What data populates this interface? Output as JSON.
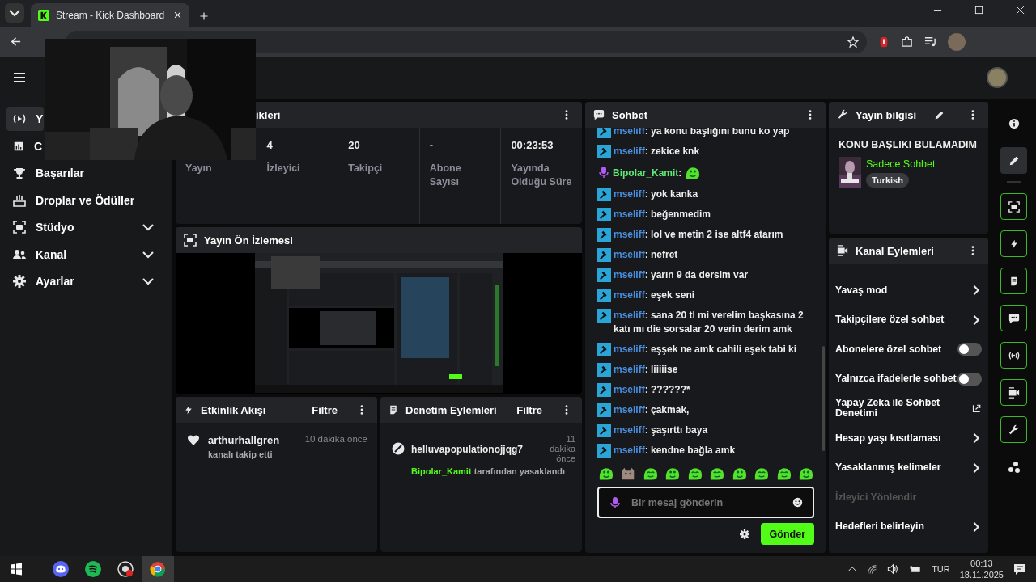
{
  "browser": {
    "tab_title": "Stream - Kick Dashboard"
  },
  "sidebar": {
    "items": [
      {
        "label": "Y",
        "kind": "link",
        "selected": true
      },
      {
        "label": "C",
        "kind": "link",
        "selected": false
      },
      {
        "label": "Başarılar",
        "kind": "link",
        "selected": false
      },
      {
        "label": "Droplar ve Ödüller",
        "kind": "link",
        "selected": false
      },
      {
        "label": "Stüdyo",
        "kind": "group",
        "selected": false,
        "expanded": false
      },
      {
        "label": "Kanal",
        "kind": "group",
        "selected": false,
        "expanded": false
      },
      {
        "label": "Ayarlar",
        "kind": "group",
        "selected": false,
        "expanded": false
      }
    ]
  },
  "stats_panel": {
    "title": "ikleri",
    "stats": [
      {
        "label": "Yayın"
      },
      {
        "value": "4",
        "label": "İzleyici"
      },
      {
        "value": "20",
        "label": "Takipçi"
      },
      {
        "value": "-",
        "label": "Abone Sayısı"
      },
      {
        "value": "00:23:53",
        "label": "Yayında Olduğu Süre"
      }
    ]
  },
  "preview_panel": {
    "title": "Yayın Ön İzlemesi"
  },
  "activity_panel": {
    "title": "Etkinlik Akışı",
    "filter": "Filtre",
    "events": [
      {
        "user": "arthurhallgren",
        "action": "kanalı takip etti",
        "time": "10 dakika önce"
      }
    ]
  },
  "moderation_panel": {
    "title": "Denetim Eylemleri",
    "filter": "Filtre",
    "actions": [
      {
        "user": "helluvapopulationojjqg7",
        "time": "11 dakika önce",
        "moderator": "Bipolar_Kamit",
        "action": "tarafından yasaklandı"
      }
    ]
  },
  "chat": {
    "title": "Sohbet",
    "messages": [
      {
        "kind": "moderator",
        "user": "mseliff",
        "color": "#4a8fe0",
        "text": ": ya konu başlığını bunu ko yap"
      },
      {
        "kind": "moderator",
        "user": "mseliff",
        "color": "#4a8fe0",
        "text": ": zekice knk"
      },
      {
        "kind": "broadcaster",
        "user": "Bipolar_Kamit",
        "color": "#5ee874",
        "text": ":"
      },
      {
        "kind": "moderator",
        "user": "mseliff",
        "color": "#4a8fe0",
        "text": ": yok kanka"
      },
      {
        "kind": "moderator",
        "user": "mseliff",
        "color": "#4a8fe0",
        "text": ": beğenmedim"
      },
      {
        "kind": "moderator",
        "user": "mseliff",
        "color": "#4a8fe0",
        "text": ": lol ve metin 2 ise altf4 atarım"
      },
      {
        "kind": "moderator",
        "user": "mseliff",
        "color": "#4a8fe0",
        "text": ": nefret"
      },
      {
        "kind": "moderator",
        "user": "mseliff",
        "color": "#4a8fe0",
        "text": ": yarın 9 da dersim var"
      },
      {
        "kind": "moderator",
        "user": "mseliff",
        "color": "#4a8fe0",
        "text": ": eşek seni"
      },
      {
        "kind": "moderator",
        "user": "mseliff",
        "color": "#4a8fe0",
        "text": ": sana 20 tl mi verelim başkasına 2 katı mı die sorsalar 20 verin derim amk"
      },
      {
        "kind": "moderator",
        "user": "mseliff",
        "color": "#4a8fe0",
        "text": ": eşşek ne amk cahili eşek tabi ki"
      },
      {
        "kind": "moderator",
        "user": "mseliff",
        "color": "#4a8fe0",
        "text": ": liiiiise"
      },
      {
        "kind": "moderator",
        "user": "mseliff",
        "color": "#4a8fe0",
        "text": ": ??????*"
      },
      {
        "kind": "moderator",
        "user": "mseliff",
        "color": "#4a8fe0",
        "text": ": çakmak,"
      },
      {
        "kind": "moderator",
        "user": "mseliff",
        "color": "#4a8fe0",
        "text": ": şaşırttı baya"
      },
      {
        "kind": "moderator",
        "user": "mseliff",
        "color": "#4a8fe0",
        "text": ": kendne bağla amk"
      }
    ],
    "input": {
      "placeholder": "Bir mesaj gönderin"
    },
    "send_button": "Gönder"
  },
  "stream_info": {
    "title": "Yayın bilgisi",
    "stream_title": "KONU BAŞLIKI BULAMADIM",
    "category": "Sadece Sohbet",
    "tags": [
      "Turkish"
    ]
  },
  "channel_actions": {
    "title": "Kanal Eylemleri",
    "items": [
      {
        "label": "Yavaş mod",
        "kind": "submenu",
        "disabled": false
      },
      {
        "label": "Takipçilere özel sohbet",
        "kind": "submenu",
        "disabled": false
      },
      {
        "label": "Abonelere özel sohbet",
        "kind": "toggle",
        "on": false,
        "disabled": false
      },
      {
        "label": "Yalnızca ifadelerle sohbet",
        "kind": "toggle",
        "on": false,
        "disabled": false
      },
      {
        "label": "Yapay Zeka ile Sohbet Denetimi",
        "kind": "external",
        "disabled": false
      },
      {
        "label": "Hesap yaşı kısıtlaması",
        "kind": "submenu",
        "disabled": false
      },
      {
        "label": "Yasaklanmış kelimeler",
        "kind": "submenu",
        "disabled": false
      },
      {
        "label": "İzleyici Yönlendir",
        "kind": "plain",
        "disabled": true
      },
      {
        "label": "Hedefleri belirleyin",
        "kind": "submenu",
        "disabled": false
      }
    ]
  },
  "rail": [
    {
      "kind": "info",
      "selected": false,
      "pinned": false
    },
    {
      "kind": "edit",
      "selected": true,
      "pinned": false
    },
    {
      "kind": "preview",
      "selected": false,
      "pinned": true
    },
    {
      "kind": "events",
      "selected": false,
      "pinned": true
    },
    {
      "kind": "log",
      "selected": false,
      "pinned": true
    },
    {
      "kind": "chat",
      "selected": false,
      "pinned": true
    },
    {
      "kind": "broadcast",
      "selected": false,
      "pinned": true
    },
    {
      "kind": "camera",
      "selected": false,
      "pinned": true
    },
    {
      "kind": "tools",
      "selected": false,
      "pinned": true
    },
    {
      "kind": "more",
      "selected": false,
      "pinned": false
    }
  ],
  "taskbar": {
    "apps": [
      {
        "kind": "discord",
        "selected": false
      },
      {
        "kind": "spotify",
        "selected": false
      },
      {
        "kind": "recorder",
        "selected": false
      },
      {
        "kind": "browser",
        "selected": true
      }
    ],
    "language": "TUR",
    "time": "00:13",
    "date": "18.11.2025"
  }
}
